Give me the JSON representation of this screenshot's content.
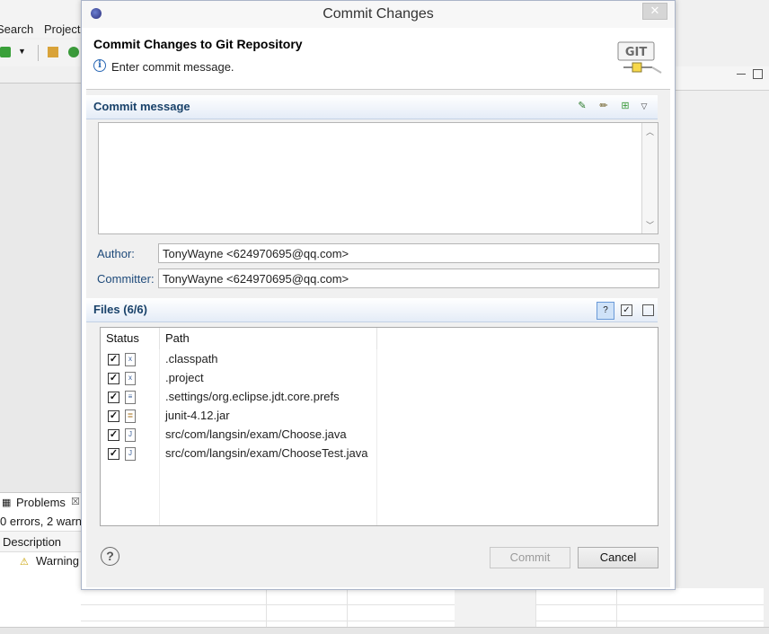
{
  "background": {
    "menu": [
      "Search",
      "Project"
    ],
    "problems_tab": "Problems",
    "problems_summary": "0 errors, 2 warn",
    "description_header": "Description",
    "warning_label": "Warning"
  },
  "dialog": {
    "window_title": "Commit Changes",
    "close_glyph": "✕",
    "header_title": "Commit Changes to Git Repository",
    "header_message": "Enter commit message.",
    "logo_text": "GIT",
    "commit_section_title": "Commit message",
    "commit_message_value": "",
    "author_label": "Author:",
    "author_value": "TonyWayne <624970695@qq.com>",
    "committer_label": "Committer:",
    "committer_value": "TonyWayne <624970695@qq.com>",
    "files_section_title": "Files (6/6)",
    "columns": [
      "Status",
      "Path"
    ],
    "files": [
      {
        "path": ".classpath",
        "checked": true,
        "icon": "xml-file-icon"
      },
      {
        "path": ".project",
        "checked": true,
        "icon": "xml-file-icon"
      },
      {
        "path": ".settings/org.eclipse.jdt.core.prefs",
        "checked": true,
        "icon": "text-file-icon"
      },
      {
        "path": "junit-4.12.jar",
        "checked": true,
        "icon": "jar-file-icon"
      },
      {
        "path": "src/com/langsin/exam/Choose.java",
        "checked": true,
        "icon": "java-file-icon"
      },
      {
        "path": "src/com/langsin/exam/ChooseTest.java",
        "checked": true,
        "icon": "java-file-icon"
      }
    ],
    "commit_button": "Commit",
    "cancel_button": "Cancel"
  },
  "colors": {
    "section_title": "#19426a",
    "label": "#1e4a7a",
    "accent": "#2a68b5"
  }
}
